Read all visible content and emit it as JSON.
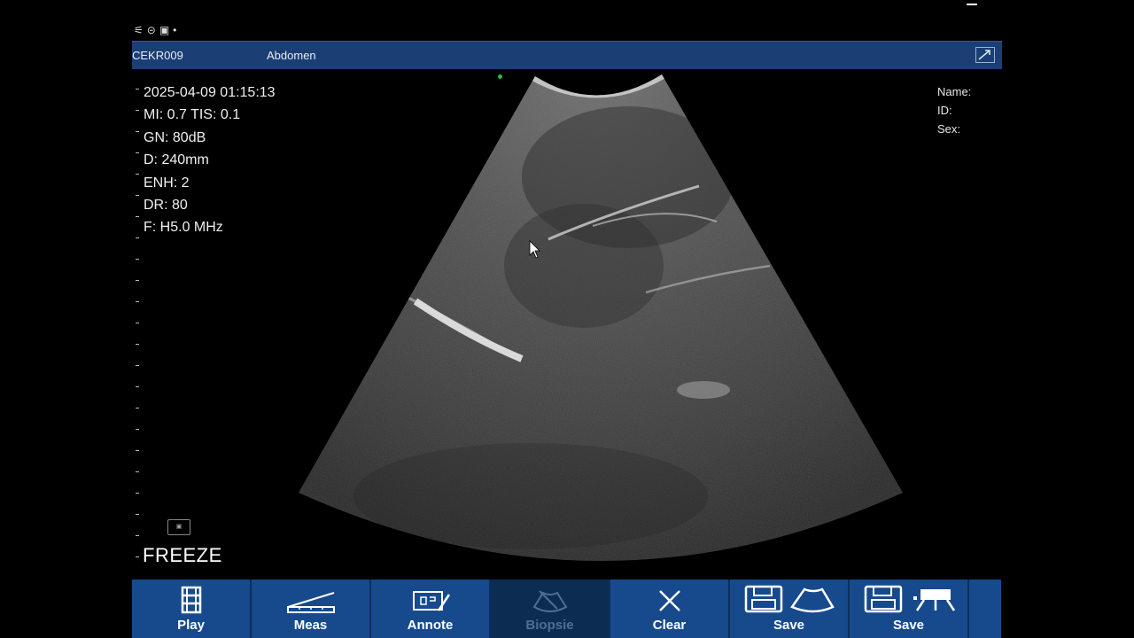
{
  "status": {
    "left_icons": [
      "settings-icon",
      "clock-icon",
      "image-icon"
    ],
    "dot": "•"
  },
  "header": {
    "exam_id": "CEKR009",
    "exam_type": "Abdomen",
    "accent": "#1b3f74"
  },
  "params": {
    "datetime": "2025-04-09 01:15:13",
    "mi_tis": "MI:  0.7  TIS:  0.1",
    "gain": "GN: 80dB",
    "depth": "D: 240mm",
    "enh": "ENH: 2",
    "dr": "DR: 80",
    "freq": "F: H5.0 MHz"
  },
  "patient": {
    "name_label": "Name:",
    "id_label": "ID:",
    "sex_label": "Sex:"
  },
  "freeze": {
    "icon_text": "▣",
    "label": "FREEZE"
  },
  "toolbar": {
    "play": "Play",
    "meas": "Meas",
    "annote": "Annote",
    "biopsie": "Biopsie",
    "clear": "Clear",
    "save_image": "Save",
    "save_video": "Save"
  }
}
